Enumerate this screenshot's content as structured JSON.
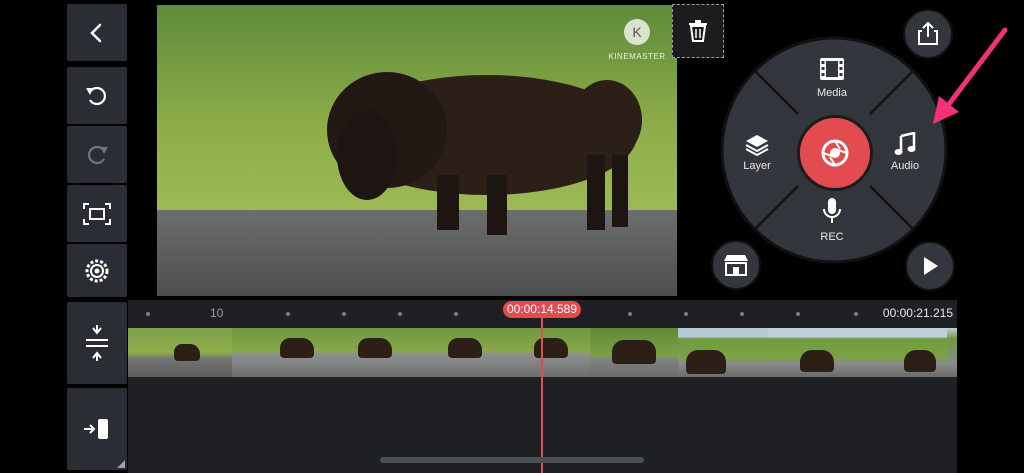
{
  "sidebar": {
    "back_icon": "chevron-left-icon",
    "undo_icon": "undo-icon",
    "redo_icon": "redo-icon",
    "crop_icon": "fullscreen-crop-icon",
    "settings_icon": "gear-icon",
    "timeline_expand_icon": "expand-vertical-icon",
    "clip_start_icon": "jump-to-start-icon"
  },
  "preview": {
    "watermark_text": "KINEMASTER",
    "delete_icon": "trash-icon"
  },
  "wheel": {
    "media_label": "Media",
    "layer_label": "Layer",
    "audio_label": "Audio",
    "rec_label": "REC",
    "center_icon": "camera-shutter-icon"
  },
  "controls": {
    "share_icon": "share-icon",
    "store_icon": "store-icon",
    "play_icon": "play-icon"
  },
  "timeline": {
    "ruler_label": "10",
    "playhead_time": "00:00:14.589",
    "end_time": "00:00:21.215"
  },
  "colors": {
    "accent_red": "#e24b50",
    "arrow_pink": "#f4307a",
    "panel": "#2a2d33"
  }
}
